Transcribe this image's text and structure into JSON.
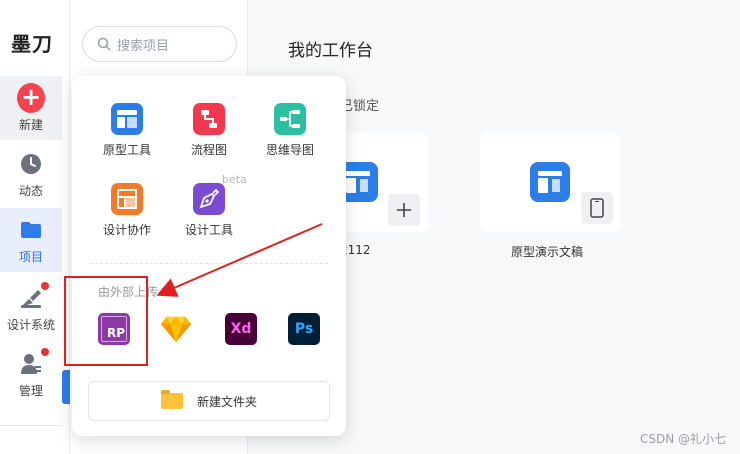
{
  "logo": "墨刀",
  "nav": {
    "new": "新建",
    "activity": "动态",
    "project": "项目",
    "design_system": "设计系统",
    "manage": "管理"
  },
  "search": {
    "placeholder": "搜索项目"
  },
  "main": {
    "title": "我的工作台",
    "locked_label": "已锁定",
    "cards": [
      {
        "caption": "2112"
      },
      {
        "caption": "原型演示文稿"
      }
    ]
  },
  "popup": {
    "tools": [
      {
        "label": "原型工具",
        "color": "#2d7de9"
      },
      {
        "label": "流程图",
        "color": "#f0384f"
      },
      {
        "label": "思维导图",
        "color": "#2bbfa4"
      },
      {
        "label": "设计协作",
        "color": "#f47a2a"
      },
      {
        "label": "设计工具",
        "color": "#7b4bd1"
      }
    ],
    "beta": "beta",
    "external_label": "由外部上传",
    "external": [
      {
        "name": "axure-rp-icon",
        "text": "RP",
        "color": "#8e3aa5"
      },
      {
        "name": "sketch-icon",
        "text": "",
        "color": "#f7b500"
      },
      {
        "name": "adobe-xd-icon",
        "text": "Xd",
        "color": "#470137"
      },
      {
        "name": "photoshop-icon",
        "text": "Ps",
        "color": "#001e36"
      }
    ],
    "new_folder": "新建文件夹"
  },
  "watermark": "CSDN @礼小七"
}
